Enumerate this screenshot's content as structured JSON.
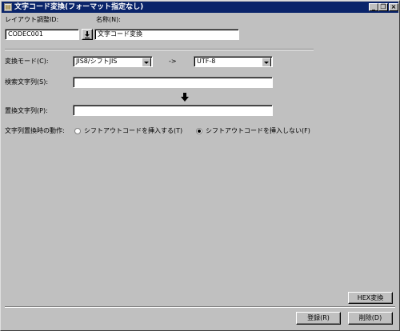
{
  "window": {
    "title": "文字コード変換(フォーマット指定なし)",
    "controls": {
      "minimize": "_",
      "restore": "❐",
      "close": "×"
    }
  },
  "layout_id": {
    "label": "レイアウト調整ID:",
    "value": "CODEC001"
  },
  "name": {
    "label": "名称(N):",
    "value": "文字コード変換"
  },
  "conversion_mode": {
    "label": "変換モード(C):",
    "from_value": "JIS8/シフトJIS",
    "arrow_text": "->",
    "to_value": "UTF-8"
  },
  "search_string": {
    "label": "検索文字列(S):",
    "value": ""
  },
  "replace_string": {
    "label": "置換文字列(P):",
    "value": ""
  },
  "replace_action": {
    "label": "文字列置換時の動作:",
    "option_insert": "シフトアウトコードを挿入する(T)",
    "option_no_insert": "シフトアウトコードを挿入しない(F)",
    "selected": "option_no_insert"
  },
  "buttons": {
    "hex": "HEX変換",
    "register": "登録(R)",
    "delete": "削除(D)"
  },
  "icons": {
    "title_icon": "app-icon",
    "lookup": "down-arrow-icon",
    "convert": "down-arrow-icon"
  }
}
